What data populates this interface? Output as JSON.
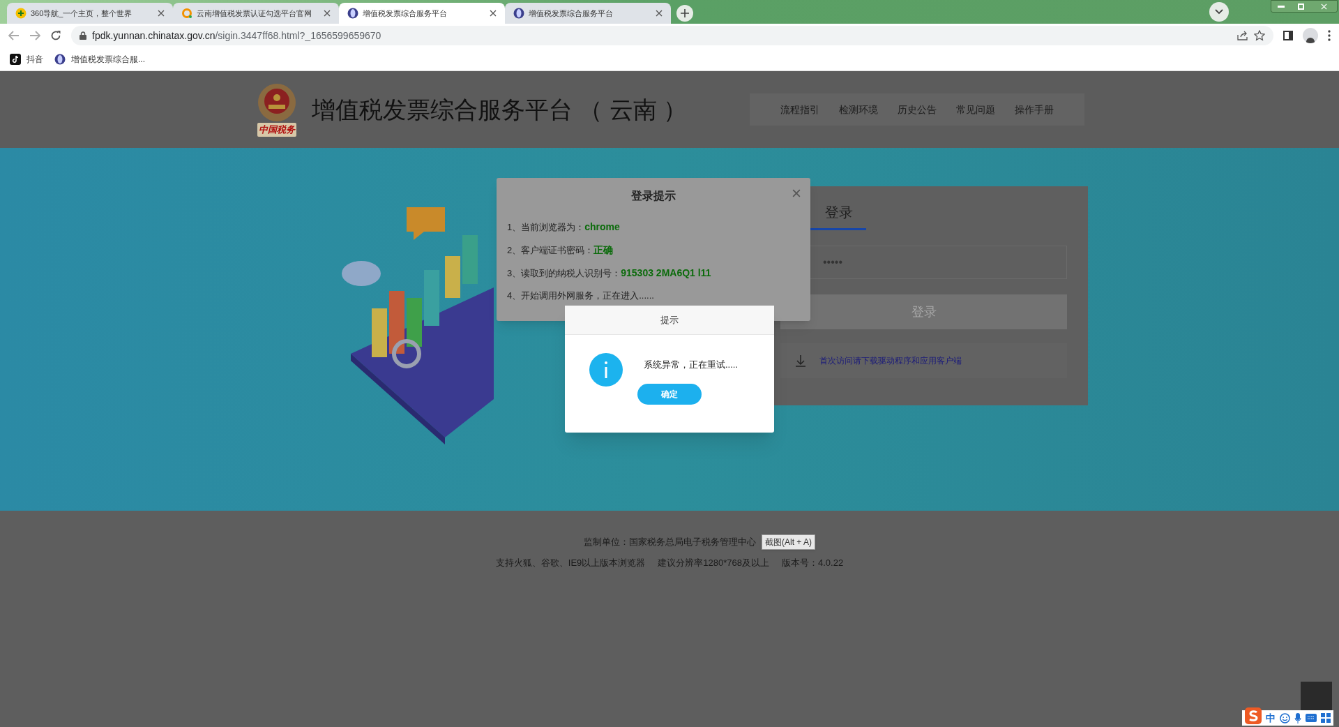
{
  "browser": {
    "tabs": [
      {
        "title": "360导航_一个主页，整个世界",
        "selected": false,
        "kind": "plus"
      },
      {
        "title": "云南增值税发票认证勾选平台官网",
        "selected": false,
        "kind": "ring"
      },
      {
        "title": "增值税发票综合服务平台",
        "selected": true,
        "kind": "globe"
      },
      {
        "title": "增值税发票综合服务平台",
        "selected": false,
        "kind": "globe"
      }
    ],
    "url_host": "fpdk.yunnan.chinatax.gov.cn",
    "url_path": "/sigin.3447ff68.html?_1656599659670",
    "bookmarks": [
      {
        "label": "抖音",
        "kind": "note"
      },
      {
        "label": "增值税发票综合服...",
        "kind": "globe"
      }
    ]
  },
  "header": {
    "emblem_caption": "中国税务",
    "title": "增值税发票综合服务平台 （ 云南 ）",
    "nav": [
      "流程指引",
      "检测环境",
      "历史公告",
      "常见问题",
      "操作手册"
    ]
  },
  "login_panel": {
    "tabs": [
      {
        "label": "登录",
        "selected": true
      }
    ],
    "password_value": "•••••",
    "login_button": "登录",
    "download_link": "首次访问请下载驱动程序和应用客户端"
  },
  "login_dialog": {
    "title": "登录提示",
    "steps": [
      {
        "text": "1、当前浏览器为：",
        "value": "chrome"
      },
      {
        "text": "2、客户端证书密码：",
        "value": "正确"
      },
      {
        "text": "3、读取到的纳税人识别号：",
        "value": "915303 2MA6Q1 l11"
      },
      {
        "text": "4、开始调用外网服务，正在进入......"
      }
    ]
  },
  "alert": {
    "title": "提示",
    "message": "系统异常，正在重试.....",
    "ok": "确定"
  },
  "footer": {
    "lines": [
      "监制单位：国家税务总局电子税务管理中心"
    ],
    "support": [
      "支持火狐、谷歌、IE9以上版本浏览器",
      "建议分辨率1280*768及以上",
      "版本号：4.0.22"
    ]
  },
  "tooltip": "截图(Alt + A)",
  "ime": {
    "lang": "中"
  }
}
